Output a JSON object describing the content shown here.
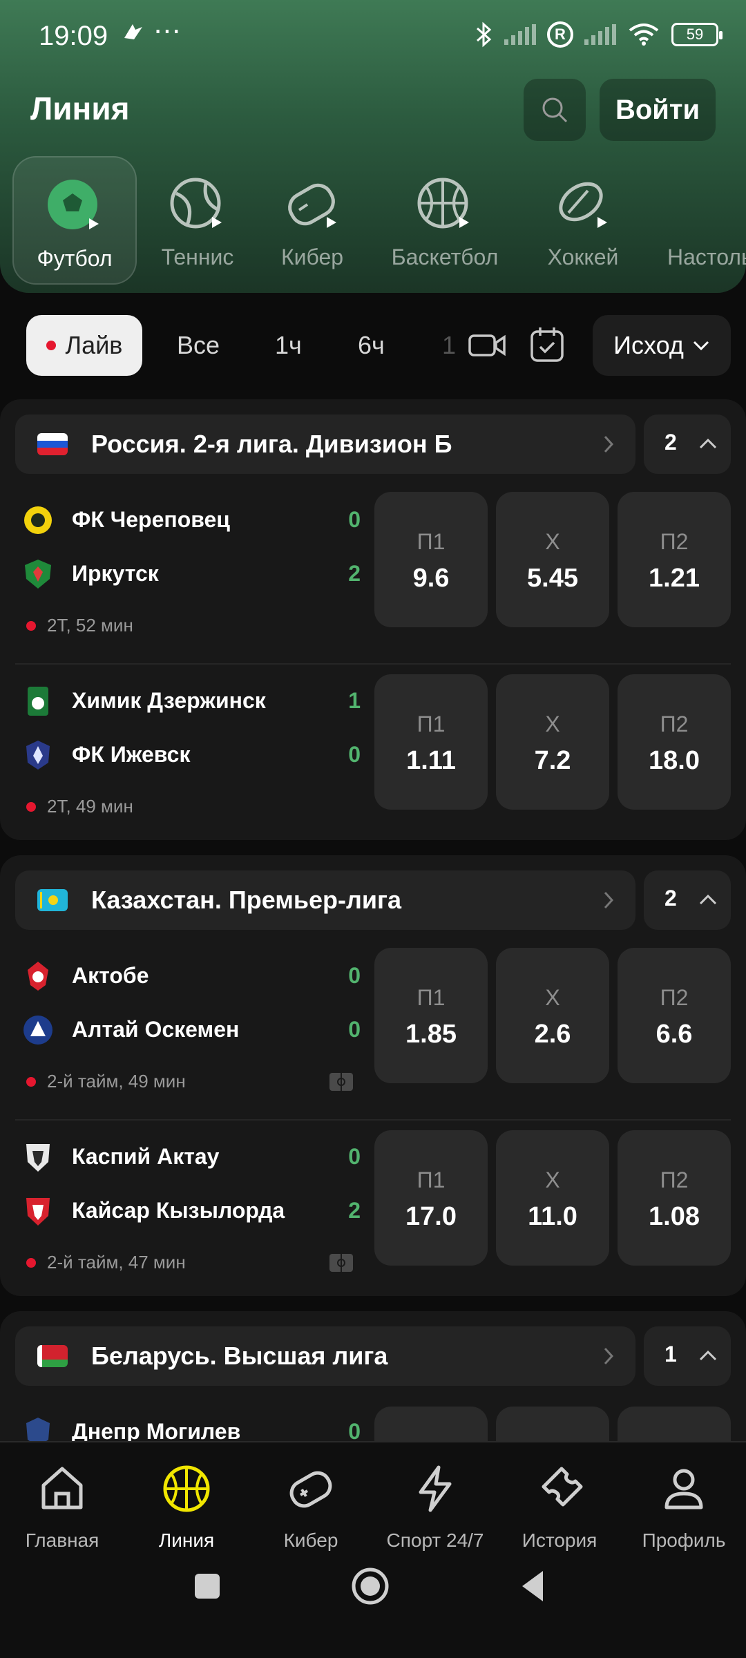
{
  "status": {
    "time": "19:09",
    "extra": "⋯",
    "battery": "59"
  },
  "header": {
    "title": "Линия",
    "login_label": "Войти"
  },
  "sports": [
    {
      "label": "Футбол",
      "icon": "football-icon",
      "active": true
    },
    {
      "label": "Теннис",
      "icon": "tennis-icon"
    },
    {
      "label": "Кибер",
      "icon": "gamepad-icon"
    },
    {
      "label": "Баскетбол",
      "icon": "basketball-icon"
    },
    {
      "label": "Хоккей",
      "icon": "hockey-icon"
    },
    {
      "label": "Настольный теннис",
      "icon": "table-tennis-icon"
    }
  ],
  "filters": {
    "live": "Лайв",
    "all": "Все",
    "h1": "1ч",
    "h6": "6ч",
    "partial": "1",
    "outcome": "Исход"
  },
  "colors": {
    "accent_green": "#52b36e",
    "live_red": "#e5172f",
    "active_nav_yellow": "#f1e600"
  },
  "leagues": [
    {
      "name": "Россия. 2-я лига. Дивизион Б",
      "count": "2",
      "matches": [
        {
          "team1": "ФК Череповец",
          "score1": "0",
          "team2": "Иркутск",
          "score2": "2",
          "time": "2Т, 52 мин",
          "odds": [
            {
              "label": "П1",
              "value": "9.6"
            },
            {
              "label": "Х",
              "value": "5.45"
            },
            {
              "label": "П2",
              "value": "1.21"
            }
          ]
        },
        {
          "team1": "Химик Дзержинск",
          "score1": "1",
          "team2": "ФК Ижевск",
          "score2": "0",
          "time": "2Т, 49 мин",
          "odds": [
            {
              "label": "П1",
              "value": "1.11"
            },
            {
              "label": "Х",
              "value": "7.2"
            },
            {
              "label": "П2",
              "value": "18.0"
            }
          ]
        }
      ]
    },
    {
      "name": "Казахстан. Премьер-лига",
      "count": "2",
      "matches": [
        {
          "team1": "Актобе",
          "score1": "0",
          "team2": "Алтай Оскемен",
          "score2": "0",
          "time": "2-й тайм, 49 мин",
          "odds": [
            {
              "label": "П1",
              "value": "1.85"
            },
            {
              "label": "Х",
              "value": "2.6"
            },
            {
              "label": "П2",
              "value": "6.6"
            }
          ]
        },
        {
          "team1": "Каспий Актау",
          "score1": "0",
          "team2": "Кайсар Кызылорда",
          "score2": "2",
          "time": "2-й тайм, 47 мин",
          "odds": [
            {
              "label": "П1",
              "value": "17.0"
            },
            {
              "label": "Х",
              "value": "11.0"
            },
            {
              "label": "П2",
              "value": "1.08"
            }
          ]
        }
      ]
    },
    {
      "name": "Беларусь. Высшая лига",
      "count": "1",
      "matches": [
        {
          "team1": "Днепр Могилев",
          "score1": "0"
        }
      ]
    }
  ],
  "nav": [
    {
      "label": "Главная",
      "icon": "home-icon"
    },
    {
      "label": "Линия",
      "icon": "basketball-icon",
      "active": true
    },
    {
      "label": "Кибер",
      "icon": "gamepad-icon"
    },
    {
      "label": "Спорт 24/7",
      "icon": "lightning-icon"
    },
    {
      "label": "История",
      "icon": "ticket-icon"
    },
    {
      "label": "Профиль",
      "icon": "profile-icon"
    }
  ]
}
